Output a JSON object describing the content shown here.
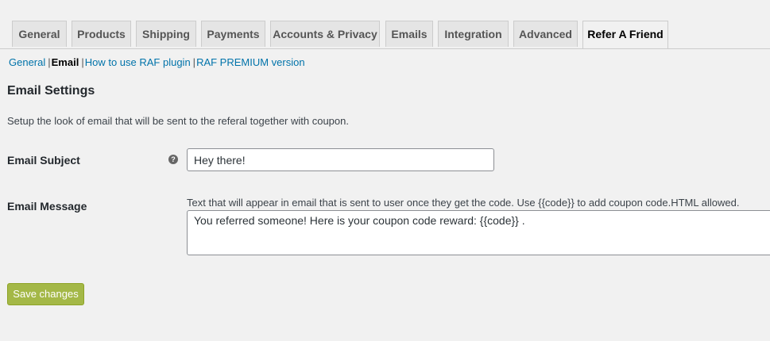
{
  "tabs": [
    {
      "label": "General",
      "active": false
    },
    {
      "label": "Products",
      "active": false
    },
    {
      "label": "Shipping",
      "active": false
    },
    {
      "label": "Payments",
      "active": false
    },
    {
      "label": "Accounts & Privacy",
      "active": false
    },
    {
      "label": "Emails",
      "active": false
    },
    {
      "label": "Integration",
      "active": false
    },
    {
      "label": "Advanced",
      "active": false
    },
    {
      "label": "Refer A Friend",
      "active": true
    }
  ],
  "subnav": {
    "general": "General",
    "email": "Email",
    "how_to": "How to use RAF plugin",
    "premium": "RAF PREMIUM version",
    "separator": "|"
  },
  "section": {
    "title": "Email Settings",
    "description": "Setup the look of email that will be sent to the referal together with coupon."
  },
  "fields": {
    "subject": {
      "label": "Email Subject",
      "value": "Hey there!",
      "help_glyph": "?"
    },
    "message": {
      "label": "Email Message",
      "description": "Text that will appear in email that is sent to user once they get the code. Use {{code}} to add coupon code.HTML allowed.",
      "value": "You referred someone! Here is your coupon code reward: {{code}} ."
    }
  },
  "actions": {
    "save_label": "Save changes"
  },
  "colors": {
    "accent": "#a4b847",
    "link": "#0073aa",
    "background": "#f1f1f1"
  }
}
